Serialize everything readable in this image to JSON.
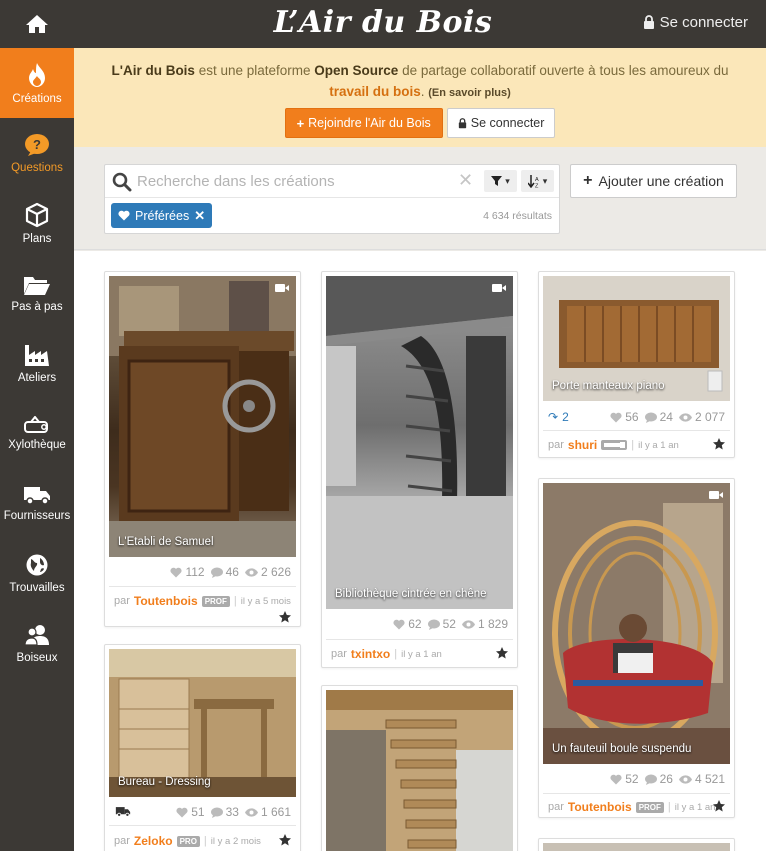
{
  "header": {
    "logo": "L’Air du Bois",
    "login_label": "Se connecter",
    "home_icon": "home-icon"
  },
  "sidebar": {
    "items": [
      {
        "label": "Créations",
        "icon": "flame-icon",
        "active": true
      },
      {
        "label": "Questions",
        "icon": "question-bubble-icon"
      },
      {
        "label": "Plans",
        "icon": "cube-icon"
      },
      {
        "label": "Pas à pas",
        "icon": "folder-icon"
      },
      {
        "label": "Ateliers",
        "icon": "factory-icon"
      },
      {
        "label": "Xylothèque",
        "icon": "wood-log-icon"
      },
      {
        "label": "Fournisseurs",
        "icon": "truck-icon"
      },
      {
        "label": "Trouvailles",
        "icon": "globe-icon"
      },
      {
        "label": "Boiseux",
        "icon": "users-icon"
      }
    ]
  },
  "banner": {
    "brand": "L'Air du Bois",
    "text1": " est une plateforme ",
    "open_source": "Open Source",
    "text2": " de partage collaboratif ouverte à tous les amoureux du ",
    "travail": "travail du bois",
    "text3": ". ",
    "more": "(En savoir plus)",
    "join_label": "Rejoindre l'Air du Bois",
    "login_label": "Se connecter"
  },
  "search": {
    "placeholder": "Recherche dans les créations",
    "tag_label": "Préférées",
    "results": "4 634 résultats",
    "add_label": "Ajouter une création"
  },
  "cards": [
    {
      "title": "L'Etabli de Samuel",
      "likes": "112",
      "comments": "46",
      "views": "2 626",
      "author": "Toutenbois",
      "badge": "PROF",
      "time": "il y a 5 mois",
      "video": true
    },
    {
      "title": "Bibliothèque cintrée en chêne",
      "likes": "62",
      "comments": "52",
      "views": "1 829",
      "author": "txintxo",
      "badge": "",
      "time": "il y a 1 an",
      "video": true
    },
    {
      "title": "Porte manteaux piano",
      "reposts": "2",
      "likes": "56",
      "comments": "24",
      "views": "2 077",
      "author": "shuri",
      "badge": "saw",
      "time": "il y a 1 an",
      "video": false
    },
    {
      "title": "Un fauteuil boule suspendu",
      "likes": "52",
      "comments": "26",
      "views": "4 521",
      "author": "Toutenbois",
      "badge": "PROF",
      "time": "il y a 1 an",
      "video": true
    },
    {
      "title": "Bureau - Dressing",
      "likes": "51",
      "comments": "33",
      "views": "1 661",
      "author": "Zeloko",
      "badge": "PRO",
      "time": "il y a 2 mois",
      "video": false
    },
    {
      "title": "",
      "video": false
    }
  ],
  "colors": {
    "accent": "#f17e1c",
    "dark": "#3c3935",
    "banner_bg": "#fbe7b9",
    "tag_blue": "#2e7ab8"
  }
}
